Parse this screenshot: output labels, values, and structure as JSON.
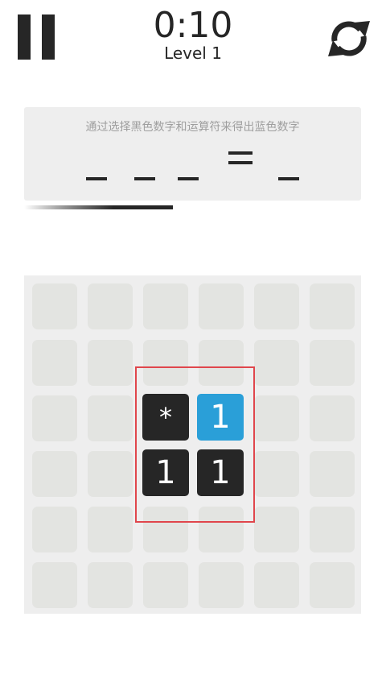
{
  "header": {
    "timer": "0:10",
    "level": "Level 1"
  },
  "puzzle": {
    "instruction": "通过选择黑色数字和运算符来得出蓝色数字",
    "equals": "="
  },
  "board": {
    "tiles": [
      {
        "text": "*",
        "kind": "operator",
        "color": "dark"
      },
      {
        "text": "1",
        "kind": "target",
        "color": "blue"
      },
      {
        "text": "1",
        "kind": "number",
        "color": "dark"
      },
      {
        "text": "1",
        "kind": "number",
        "color": "dark"
      }
    ]
  },
  "icons": {
    "pause": "pause-icon",
    "restart": "restart-icon"
  },
  "colors": {
    "dark_tile": "#262626",
    "target_tile": "#2a9fd8",
    "empty_cell": "#e3e4e1",
    "highlight": "#e0464c"
  }
}
